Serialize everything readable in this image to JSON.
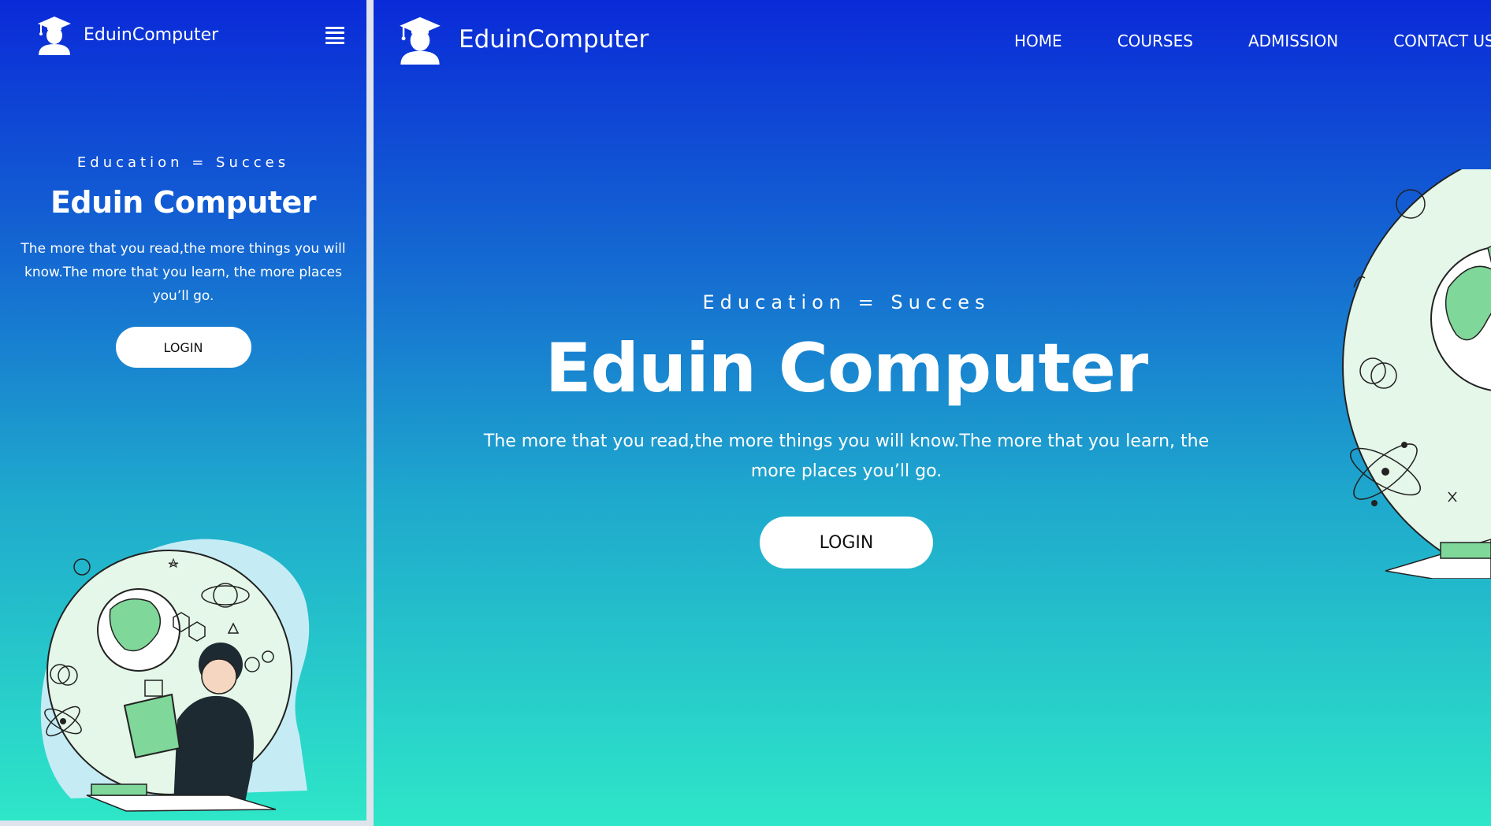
{
  "brand": {
    "name": "EduinComputer"
  },
  "hero": {
    "tagline": "Education = Succes",
    "title": "Eduin Computer",
    "description": "The more that you read,the more things you will know.The more that you learn, the more places you’ll go.",
    "login_label": "LOGIN"
  },
  "nav": {
    "items": [
      {
        "label": "HOME"
      },
      {
        "label": "COURSES"
      },
      {
        "label": "ADMISSION"
      },
      {
        "label": "CONTACT US"
      }
    ]
  },
  "icons": {
    "logo": "graduate-cap-person-icon",
    "menu": "hamburger-menu-icon"
  },
  "colors": {
    "gradient_top": "#0a2ad8",
    "gradient_mid": "#1ea8cd",
    "gradient_bottom": "#2ee6c8",
    "button_bg": "#ffffff",
    "illustration_green": "#7fd79a",
    "illustration_mint": "#e4f7e8"
  }
}
